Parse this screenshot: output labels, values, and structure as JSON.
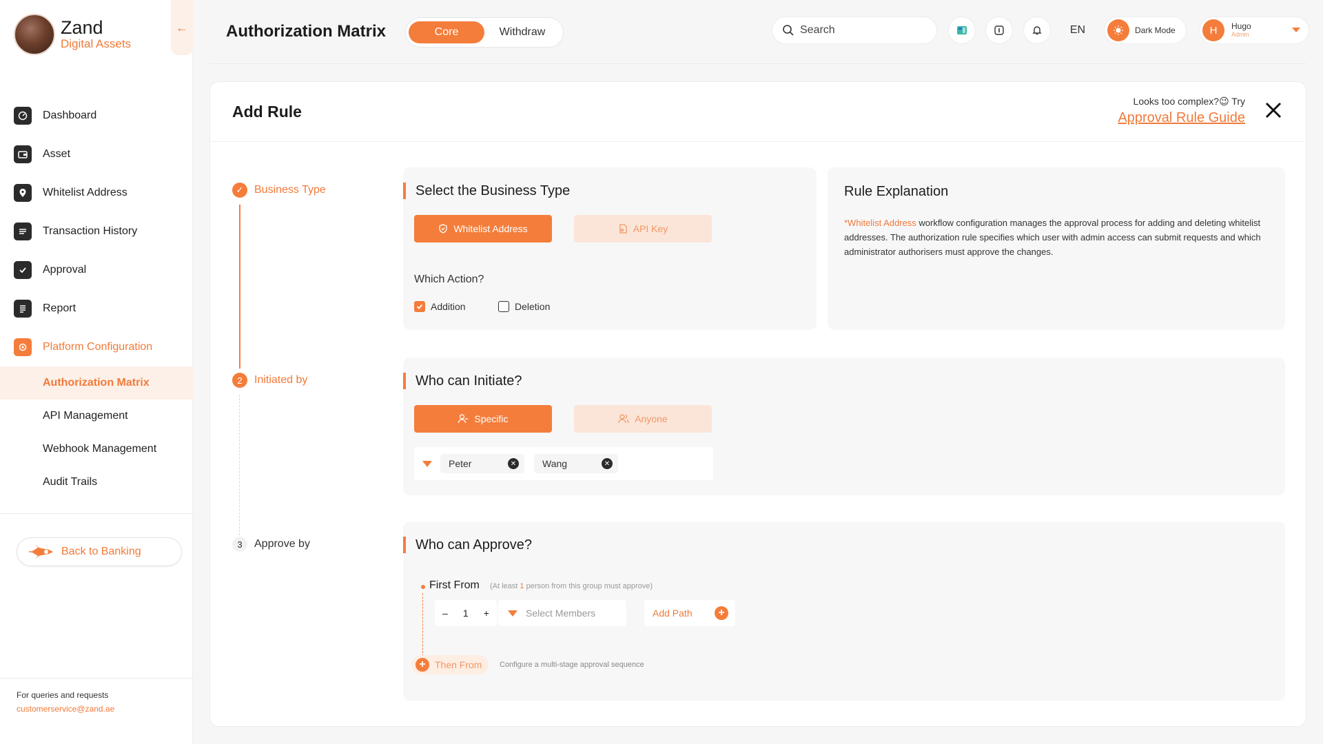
{
  "brand": {
    "title": "Zand",
    "subtitle": "Digital Assets"
  },
  "sidebar": {
    "items": [
      {
        "label": "Dashboard",
        "icon": "dashboard-icon"
      },
      {
        "label": "Asset",
        "icon": "wallet-icon"
      },
      {
        "label": "Whitelist Address",
        "icon": "location-pin-icon"
      },
      {
        "label": "Transaction History",
        "icon": "list-icon"
      },
      {
        "label": "Approval",
        "icon": "checkbox-icon"
      },
      {
        "label": "Report",
        "icon": "report-icon"
      },
      {
        "label": "Platform Configuration",
        "icon": "settings-icon"
      }
    ],
    "sub_items": [
      {
        "label": "Authorization Matrix",
        "active": true
      },
      {
        "label": "API Management"
      },
      {
        "label": "Webhook Management"
      },
      {
        "label": "Audit Trails"
      }
    ],
    "back_label": "Back to Banking",
    "contact_label": "For queries and requests",
    "contact_email": "customerservice@zand.ae"
  },
  "header": {
    "title": "Authorization Matrix",
    "tabs": [
      {
        "label": "Core",
        "active": true
      },
      {
        "label": "Withdraw"
      }
    ],
    "search_placeholder": "Search",
    "language": "EN",
    "dark_mode_label": "Dark Mode",
    "user": {
      "initial": "H",
      "name": "Hugo",
      "role": "Admin"
    }
  },
  "card": {
    "title": "Add Rule",
    "hint_text": "Looks too complex?😉 Try",
    "hint_link": "Approval Rule Guide"
  },
  "steps": [
    {
      "number": "✓",
      "label": "Business Type",
      "state": "done"
    },
    {
      "number": "2",
      "label": "Initiated by",
      "state": "current"
    },
    {
      "number": "3",
      "label": "Approve by",
      "state": "pending"
    }
  ],
  "business_type": {
    "title": "Select the Business Type",
    "options": [
      {
        "label": "Whitelist Address",
        "selected": true
      },
      {
        "label": "API Key",
        "selected": false
      }
    ],
    "action_question": "Which Action?",
    "actions": [
      {
        "label": "Addition",
        "checked": true
      },
      {
        "label": "Deletion",
        "checked": false
      }
    ]
  },
  "explanation": {
    "title": "Rule Explanation",
    "highlight": "*Whitelist Address",
    "text": " workflow configuration manages the approval process for adding and deleting whitelist addresses. The authorization rule specifies which user with admin access can submit requests and which administrator authorisers must approve the changes."
  },
  "initiate": {
    "title": "Who can Initiate?",
    "options": [
      {
        "label": "Specific",
        "selected": true
      },
      {
        "label": "Anyone",
        "selected": false
      }
    ],
    "members": [
      "Peter",
      "Wang"
    ]
  },
  "approve": {
    "title": "Who can Approve?",
    "first_from_label": "First From",
    "first_from_note_prefix": "(At least ",
    "first_from_note_count": "1",
    "first_from_note_suffix": " person from this group must approve)",
    "count": "1",
    "select_members_placeholder": "Select Members",
    "add_path_label": "Add Path",
    "then_from_label": "Then From",
    "then_from_note": "Configure a multi-stage approval sequence"
  },
  "colors": {
    "accent": "#f47d3b",
    "accent_light": "#fbe5d8",
    "text": "#1c1c1c"
  }
}
